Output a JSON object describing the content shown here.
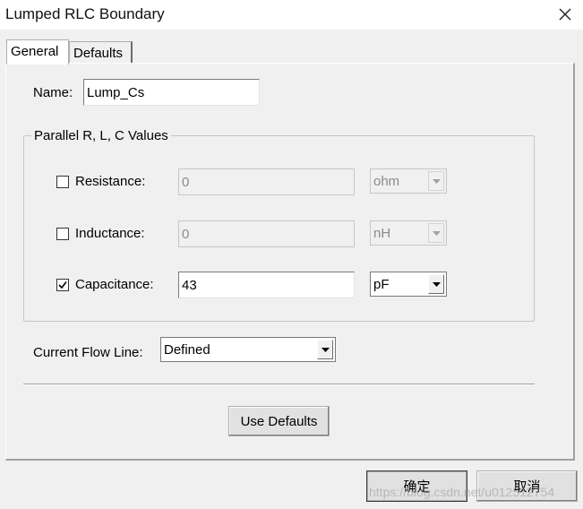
{
  "window": {
    "title": "Lumped RLC Boundary",
    "close_icon": "close-icon"
  },
  "tabs": [
    {
      "label": "General",
      "active": true
    },
    {
      "label": "Defaults",
      "active": false
    }
  ],
  "name_field": {
    "label": "Name:",
    "value": "Lump_Cs"
  },
  "group": {
    "title": "Parallel R, L, C Values",
    "rows": [
      {
        "label": "Resistance:",
        "checked": false,
        "value": "0",
        "unit": "ohm",
        "enabled": false
      },
      {
        "label": "Inductance:",
        "checked": false,
        "value": "0",
        "unit": "nH",
        "enabled": false
      },
      {
        "label": "Capacitance:",
        "checked": true,
        "value": "43",
        "unit": "pF",
        "enabled": true
      }
    ]
  },
  "current_flow": {
    "label": "Current Flow Line:",
    "value": "Defined"
  },
  "buttons": {
    "use_defaults": "Use Defaults",
    "ok": "确定",
    "cancel": "取消"
  },
  "watermark": "https://blog.csdn.net/u012512754",
  "colors": {
    "window_bg": "#f0f0f0",
    "textbox_bg": "#ffffff",
    "disabled_text": "#8a8a8a"
  }
}
